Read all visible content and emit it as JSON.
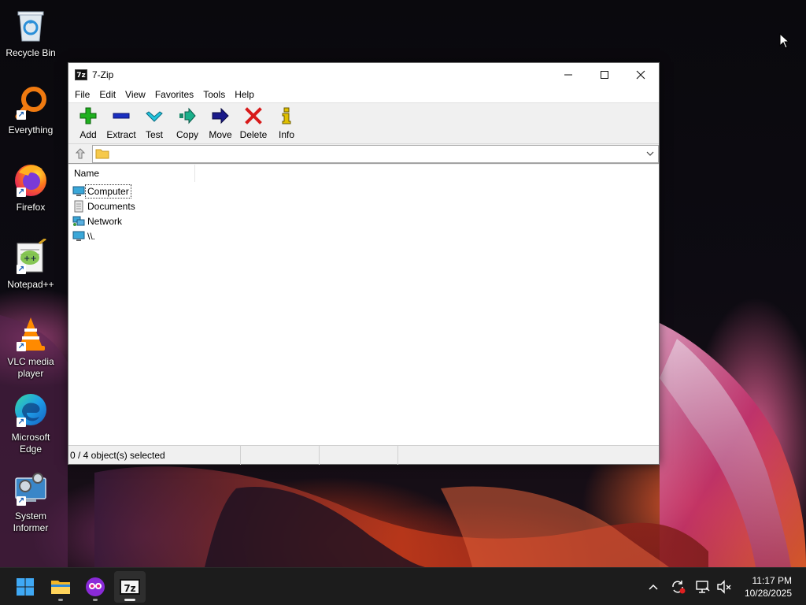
{
  "desktop": {
    "icons": [
      {
        "label": "Recycle Bin",
        "icon": "recycle-bin-icon"
      },
      {
        "label": "Everything",
        "icon": "everything-search-icon"
      },
      {
        "label": "Firefox",
        "icon": "firefox-icon"
      },
      {
        "label": "Notepad++",
        "icon": "notepad-plus-plus-icon"
      },
      {
        "label": "VLC media player",
        "icon": "vlc-icon"
      },
      {
        "label": "Microsoft Edge",
        "icon": "edge-icon"
      },
      {
        "label": "System Informer",
        "icon": "system-informer-icon"
      }
    ]
  },
  "window": {
    "title": "7-Zip",
    "app_icon_text": "7z",
    "controls": {
      "minimize": "—",
      "maximize": "☐",
      "close": "✕"
    },
    "menu": [
      "File",
      "Edit",
      "View",
      "Favorites",
      "Tools",
      "Help"
    ],
    "toolbar": [
      {
        "label": "Add",
        "icon": "add-plus-icon",
        "color": "#1aa01a"
      },
      {
        "label": "Extract",
        "icon": "extract-minus-icon",
        "color": "#1a2fb0"
      },
      {
        "label": "Test",
        "icon": "test-check-icon",
        "color": "#1ab0c8"
      },
      {
        "label": "Copy",
        "icon": "copy-arrow-icon",
        "color": "#1a9a7a"
      },
      {
        "label": "Move",
        "icon": "move-arrow-icon",
        "color": "#1a1a8a"
      },
      {
        "label": "Delete",
        "icon": "delete-x-icon",
        "color": "#d01a1a"
      },
      {
        "label": "Info",
        "icon": "info-icon",
        "color": "#c8a800"
      }
    ],
    "address": {
      "value": ""
    },
    "columns": {
      "name": "Name"
    },
    "rows": [
      {
        "label": "Computer",
        "icon": "computer-icon"
      },
      {
        "label": "Documents",
        "icon": "documents-icon"
      },
      {
        "label": "Network",
        "icon": "network-icon"
      },
      {
        "label": "\\\\.",
        "icon": "device-icon"
      }
    ],
    "status": {
      "selection": "0 / 4 object(s) selected"
    }
  },
  "taskbar": {
    "apps": [
      "start-icon",
      "file-explorer-icon",
      "system-informer-taskbar-icon",
      "7zip-taskbar-icon"
    ],
    "active_app_text": "7z",
    "clock": {
      "time": "11:17 PM",
      "date": "10/28/2025"
    }
  }
}
